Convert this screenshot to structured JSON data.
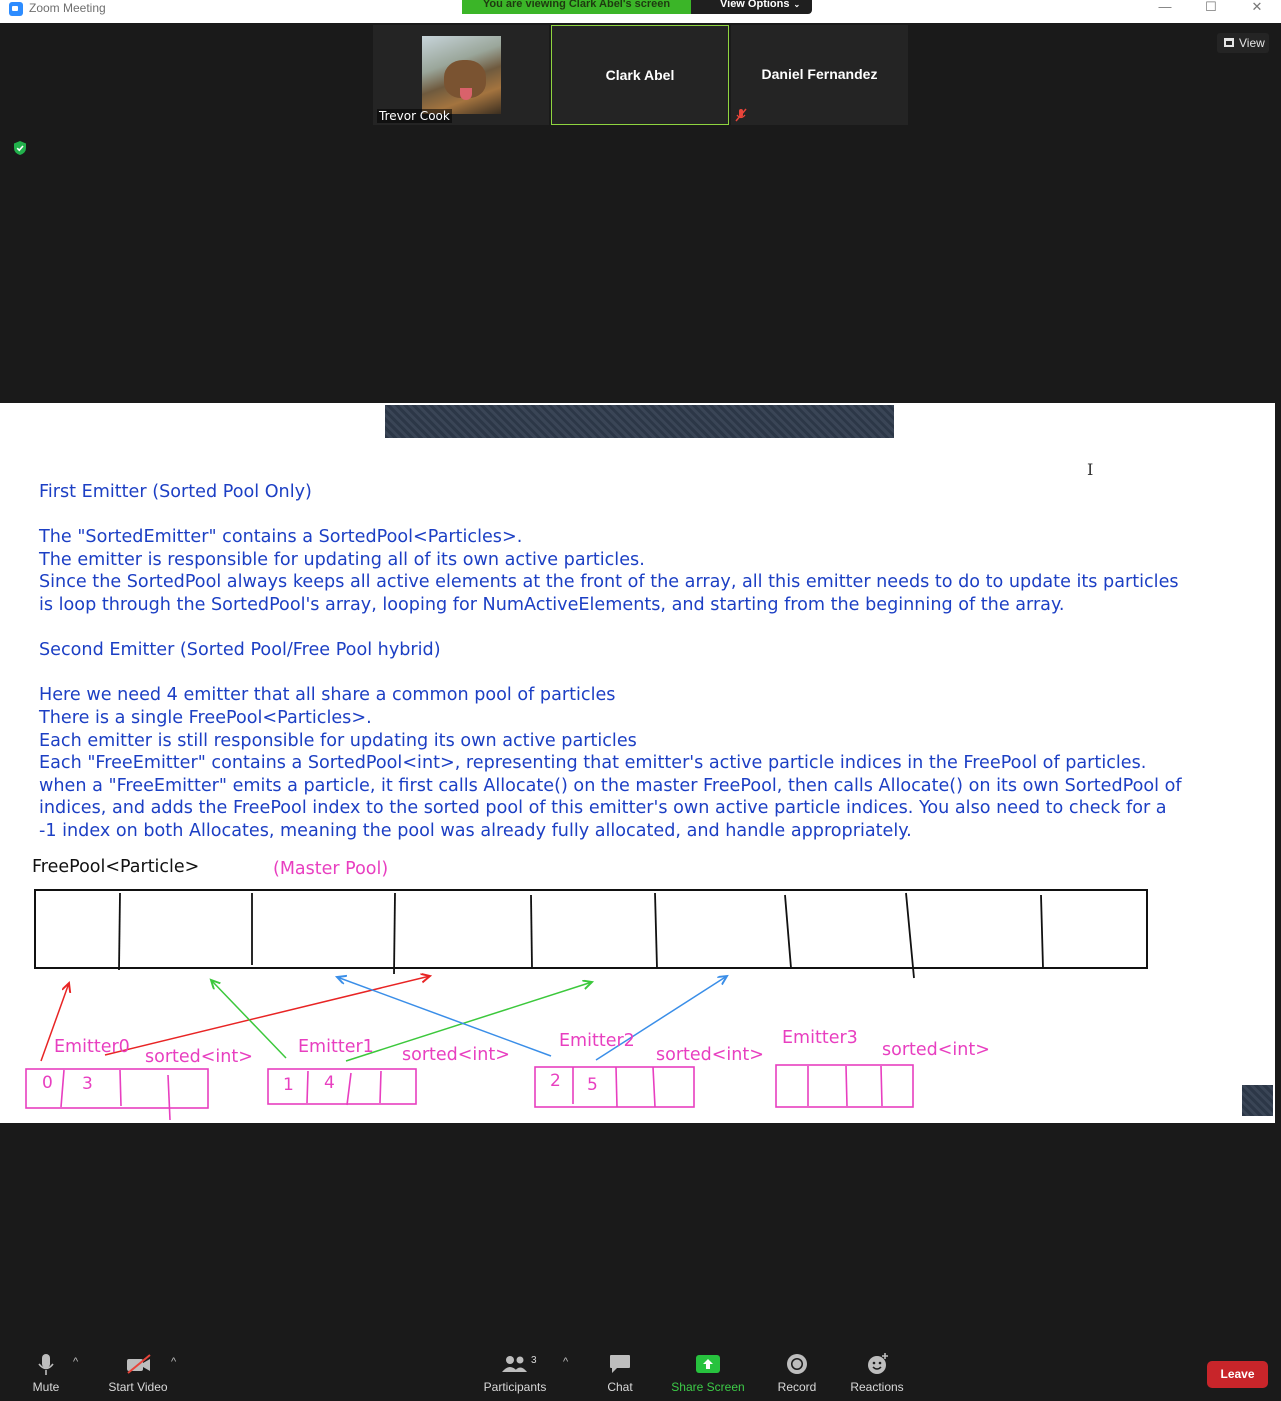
{
  "window": {
    "title": "Zoom Meeting",
    "viewing_banner": "You are viewing Clark Abel's screen",
    "view_options_label": "View Options",
    "controls": [
      "—",
      "☐",
      "✕"
    ]
  },
  "participants": {
    "thumbnails": [
      {
        "name": "Trevor Cook",
        "has_video": true
      },
      {
        "name": "Clark Abel",
        "has_video": false,
        "active_speaker": true
      },
      {
        "name": "Daniel Fernandez",
        "has_video": false,
        "muted": true
      }
    ],
    "view_button_label": "View"
  },
  "shared_document": {
    "lines": [
      "First Emitter (Sorted Pool Only)",
      "",
      "The \"SortedEmitter\" contains a SortedPool<Particles>.",
      "The emitter is responsible for updating all of its own active particles.",
      "Since the SortedPool always keeps all active elements at the front of the array, all this emitter needs to do to update its particles",
      "is loop through the SortedPool's array, looping for NumActiveElements, and starting from the beginning of the array.",
      "",
      "Second Emitter (Sorted Pool/Free Pool hybrid)",
      "",
      "Here we need 4 emitter that all share a common pool of particles",
      "There is a single FreePool<Particles>.",
      "Each emitter is still responsible for updating its own active particles",
      "Each \"FreeEmitter\" contains a SortedPool<int>, representing that emitter's active particle indices in the FreePool of particles.",
      "when a \"FreeEmitter\" emits a particle, it first calls Allocate() on the master FreePool, then calls Allocate() on its own SortedPool of",
      "indices, and adds the FreePool index to the sorted pool of this emitter's own active particle indices. You also need to check for a",
      "-1 index on both Allocates, meaning the pool was already fully allocated, and handle appropriately."
    ],
    "diagram": {
      "freepool_label": "FreePool<Particle>",
      "masterpool_label": "(Master Pool)",
      "emitters": [
        {
          "name": "Emitter0",
          "pool_label": "sorted<int>",
          "values": [
            "0",
            "3"
          ]
        },
        {
          "name": "Emitter1",
          "pool_label": "sorted<int>",
          "values": [
            "1",
            "4"
          ]
        },
        {
          "name": "Emitter2",
          "pool_label": "sorted<int>",
          "values": [
            "2",
            "5"
          ]
        },
        {
          "name": "Emitter3",
          "pool_label": "sorted<int>",
          "values": []
        }
      ],
      "colors": {
        "emitter0": "#e82424",
        "emitter1": "#3cc83c",
        "emitter2": "#3a8ee8",
        "pink": "#e83fc0"
      }
    }
  },
  "toolbar": {
    "mute": "Mute",
    "start_video": "Start Video",
    "participants": "Participants",
    "participants_count": "3",
    "chat": "Chat",
    "share_screen": "Share Screen",
    "record": "Record",
    "reactions": "Reactions",
    "leave": "Leave"
  }
}
